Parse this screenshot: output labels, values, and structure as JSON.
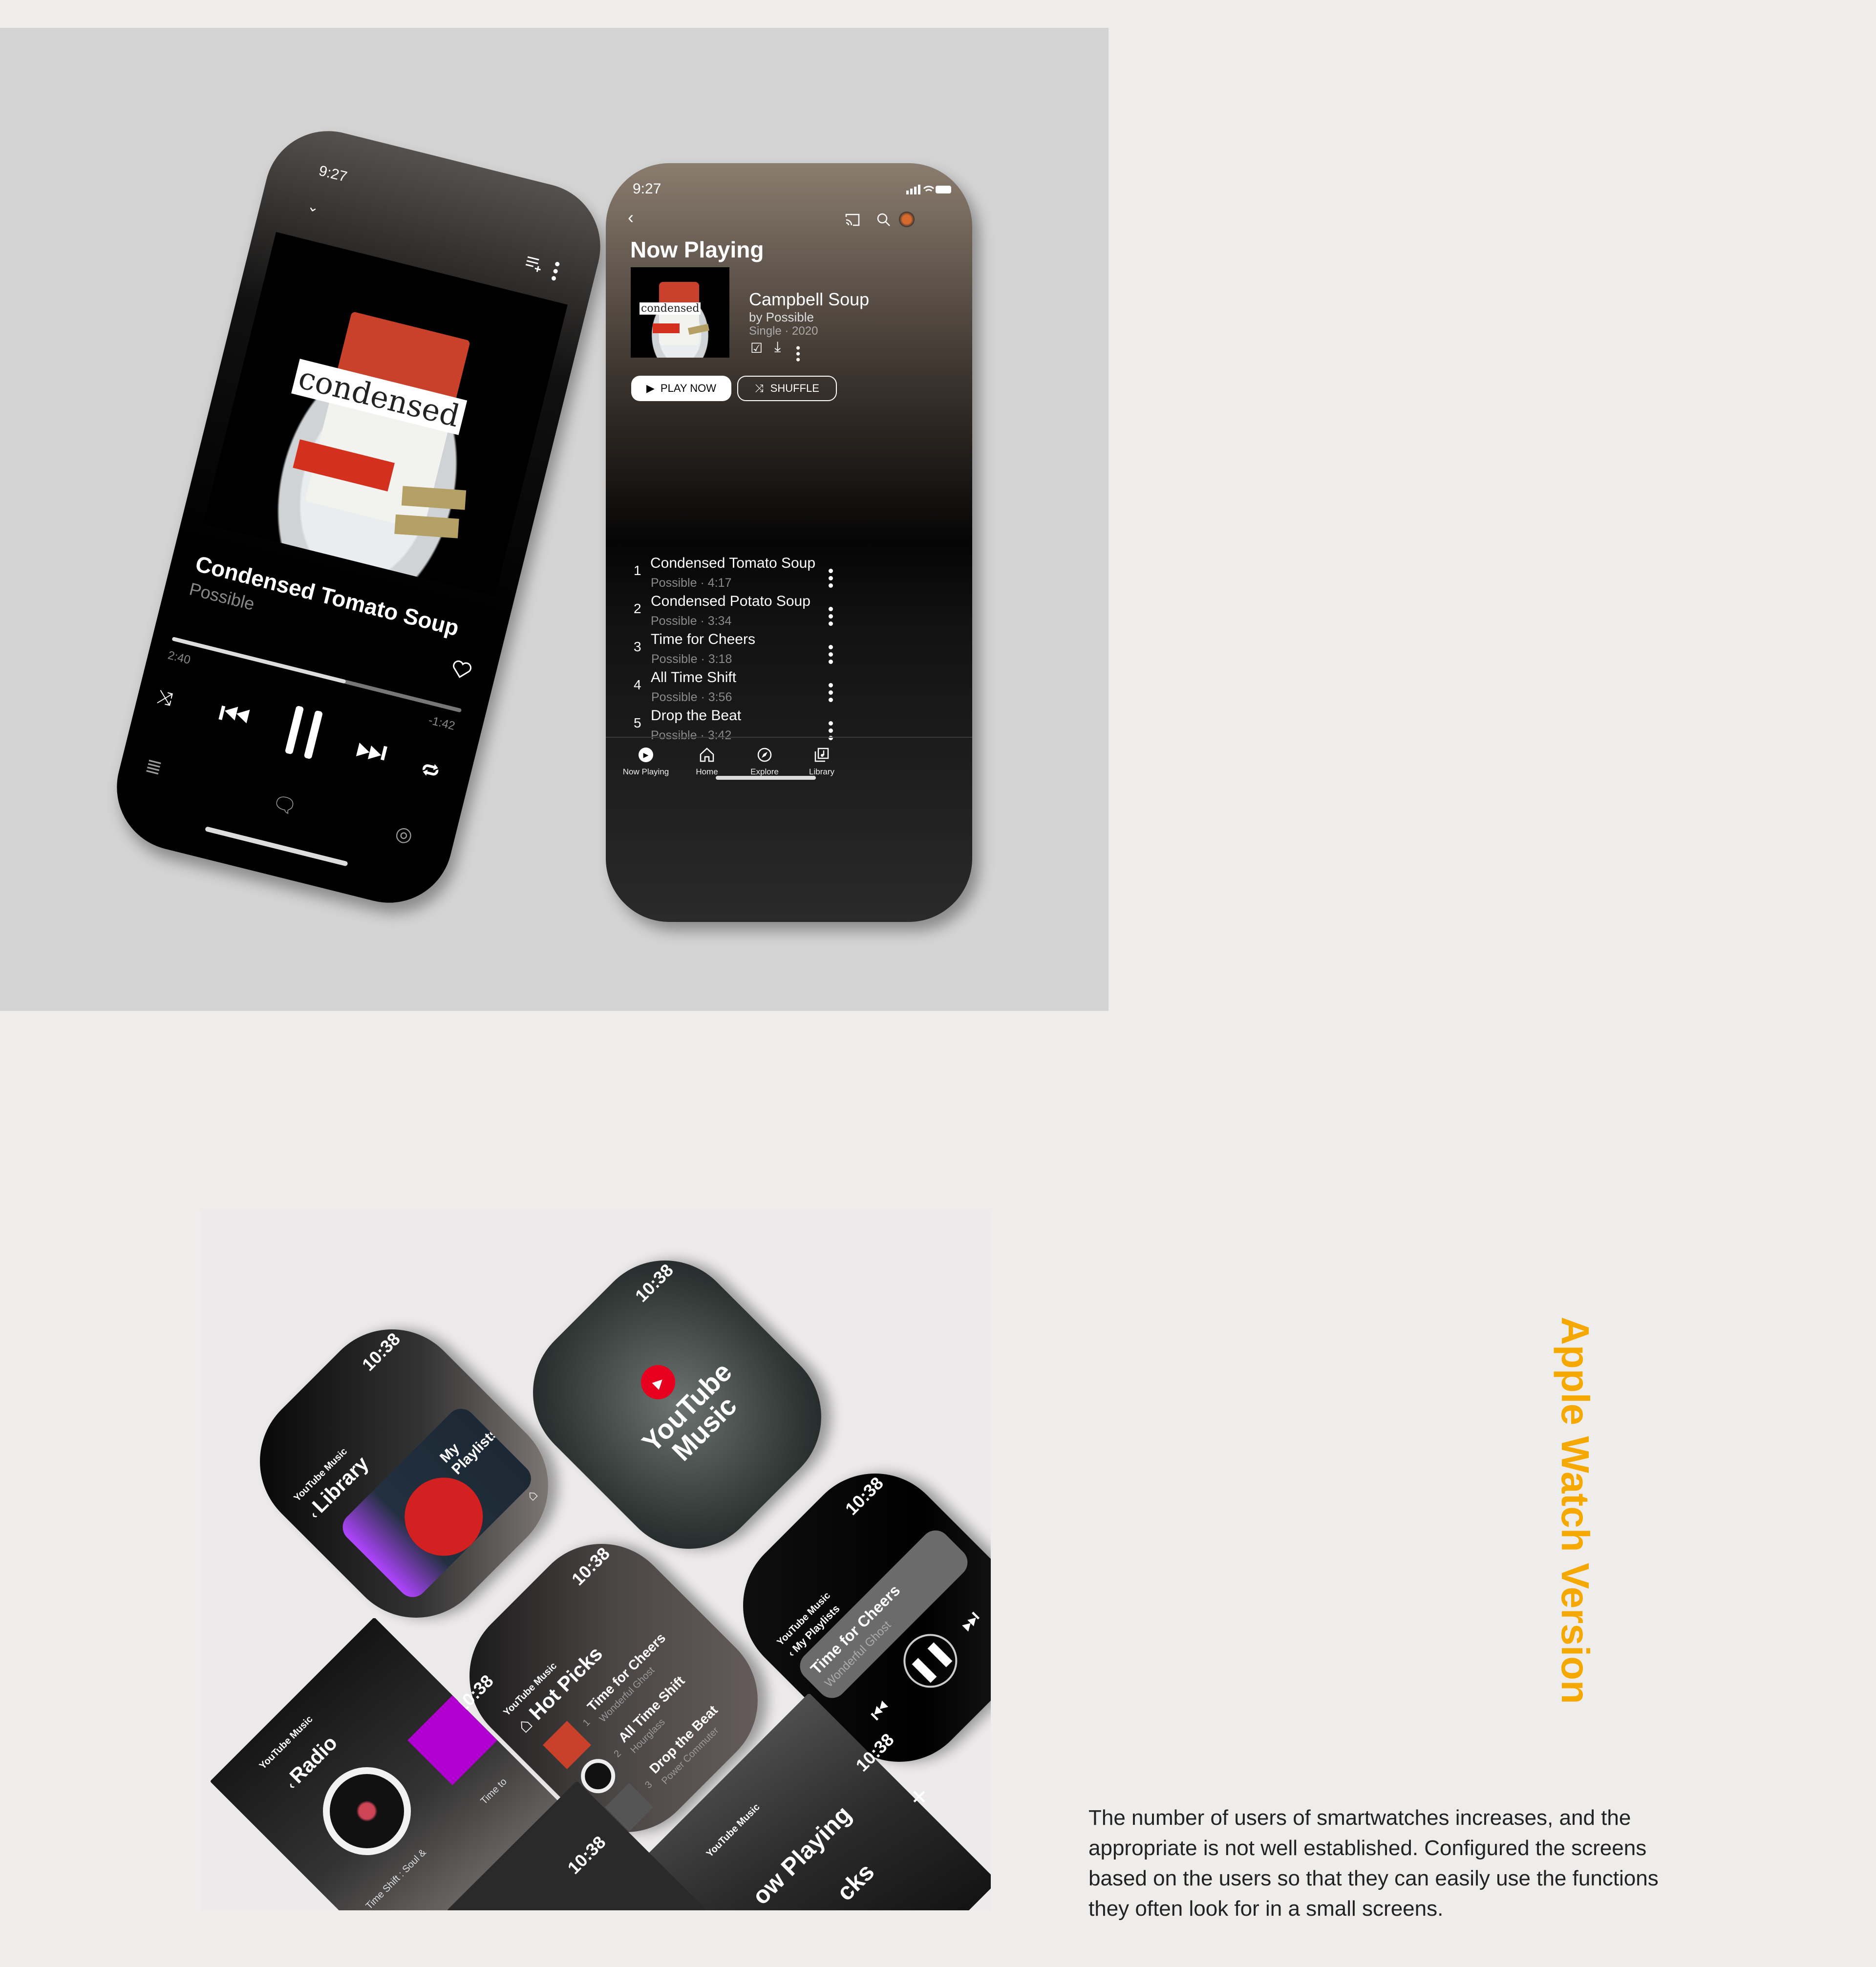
{
  "colors": {
    "accent": "#f5a800",
    "youtube_red": "#e8001f",
    "panel": "#d4d4d4",
    "background": "#eeedeb"
  },
  "phone_player": {
    "status_time": "9:27",
    "album_art_text": "condensed",
    "song_title": "Condensed Tomato Soup",
    "artist": "Possible",
    "elapsed": "2:40",
    "remaining": "-1:42",
    "progress_fraction": 0.6,
    "icons": [
      "chevron-down-icon",
      "add-to-queue-icon",
      "more-icon",
      "heart-icon",
      "shuffle-icon",
      "previous-icon",
      "pause-icon",
      "next-icon",
      "repeat-icon",
      "queue-icon",
      "lyrics-icon",
      "related-icon"
    ]
  },
  "phone_now_playing": {
    "status_time": "9:27",
    "page_title": "Now Playing",
    "album": {
      "title": "Campbell Soup",
      "artist": "by Possible",
      "meta": "Single · 2020",
      "art_text": "condensed"
    },
    "play_label": "PLAY NOW",
    "shuffle_label": "SHUFFLE",
    "tracks": [
      {
        "num": "1",
        "title": "Condensed Tomato Soup",
        "sub": "Possible · 4:17"
      },
      {
        "num": "2",
        "title": "Condensed Potato Soup",
        "sub": "Possible · 3:34"
      },
      {
        "num": "3",
        "title": "Time for Cheers",
        "sub": "Possible · 3:18"
      },
      {
        "num": "4",
        "title": "All Time Shift",
        "sub": "Possible · 3:56"
      },
      {
        "num": "5",
        "title": "Drop the Beat",
        "sub": "Possible · 3:42"
      }
    ],
    "nav": [
      {
        "label": "Now Playing",
        "icon": "now-playing-icon"
      },
      {
        "label": "Home",
        "icon": "home-icon"
      },
      {
        "label": "Explore",
        "icon": "explore-icon"
      },
      {
        "label": "Library",
        "icon": "library-icon"
      }
    ]
  },
  "watches": {
    "time": "10:38",
    "brand": "YouTube Music",
    "library": {
      "title": "Library",
      "card": "My Playlists"
    },
    "splash": {
      "logo_line1": "YouTube",
      "logo_line2": "Music"
    },
    "player": {
      "breadcrumb": "My Playlists",
      "song": "Time for Cheers",
      "artist": "Wonderful Ghost"
    },
    "hot_picks": {
      "title": "Hot Picks",
      "items": [
        {
          "num": "1",
          "title": "Time for Cheers",
          "artist": "Wonderful Ghost"
        },
        {
          "num": "2",
          "title": "All Time Shift",
          "artist": "Hourglass"
        },
        {
          "num": "3",
          "title": "Drop the Beat",
          "artist": "Power Commuter"
        }
      ]
    },
    "radio": {
      "title": "Radio",
      "item1": "Time Shift : Soul &",
      "item2": "Time to"
    },
    "now_playing": {
      "title_partial": "ow Playing",
      "sub_partial": "cks"
    }
  },
  "section_title": "Apple Watch Version",
  "description": "The number of users of smartwatches increases,  and the appropriate is not well established.  Configured the screens based on the users so that they can easily use the functions they often look for in a small screens."
}
